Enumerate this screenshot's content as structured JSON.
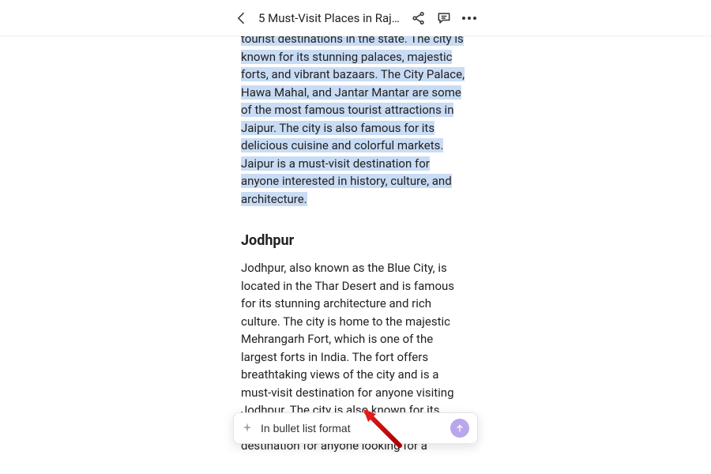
{
  "header": {
    "title": "5 Must-Visit Places in Raj…"
  },
  "doc": {
    "para1_selected": "tourist destinations in the state. The city is known for its stunning palaces, majestic forts, and vibrant bazaars. The City Palace, Hawa Mahal, and Jantar Mantar are some of the most famous tourist attractions in Jaipur. The city is also famous for its delicious cuisine and colorful markets. Jaipur is a must-visit destination for anyone interested in history, culture, and architecture.",
    "h2": "Jodhpur",
    "para2": "Jodhpur, also known as the Blue City, is located in the Thar Desert and is famous for its stunning architecture and rich culture. The city is home to the majestic Mehrangarh Fort, which is one of the largest forts in India. The fort offers breathtaking views of the city and is a must-visit destination for anyone visiting Jodhpur. The city is also known for its warm hospitality. Jodhpur is a perfect destination for anyone looking for a"
  },
  "floatbar": {
    "input_value": "In bullet list format"
  }
}
